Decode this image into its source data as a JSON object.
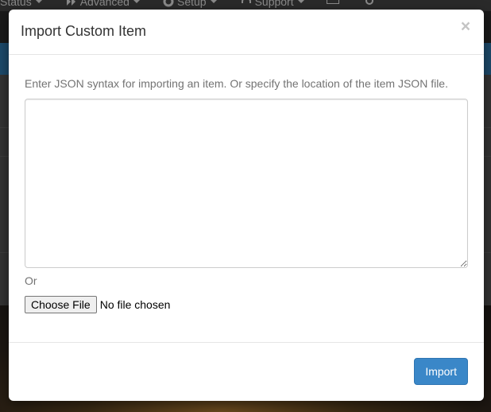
{
  "background": {
    "nav": [
      {
        "label": "Status",
        "icon": "none"
      },
      {
        "label": "Advanced",
        "icon": "double-chevron-right-icon"
      },
      {
        "label": "Setup",
        "icon": "gear-icon"
      },
      {
        "label": "Support",
        "icon": "headphones-icon"
      }
    ]
  },
  "modal": {
    "title": "Import Custom Item",
    "close_symbol": "×",
    "help_text": "Enter JSON syntax for importing an item. Or specify the location of the item JSON file.",
    "textarea_value": "",
    "or_text": "Or",
    "file_button_label": "Choose File",
    "file_status": "No file chosen",
    "import_label": "Import"
  },
  "colors": {
    "primary": "#3a87c8",
    "overlay": "#1a1a1a",
    "text": "#333333",
    "muted": "#737373"
  }
}
